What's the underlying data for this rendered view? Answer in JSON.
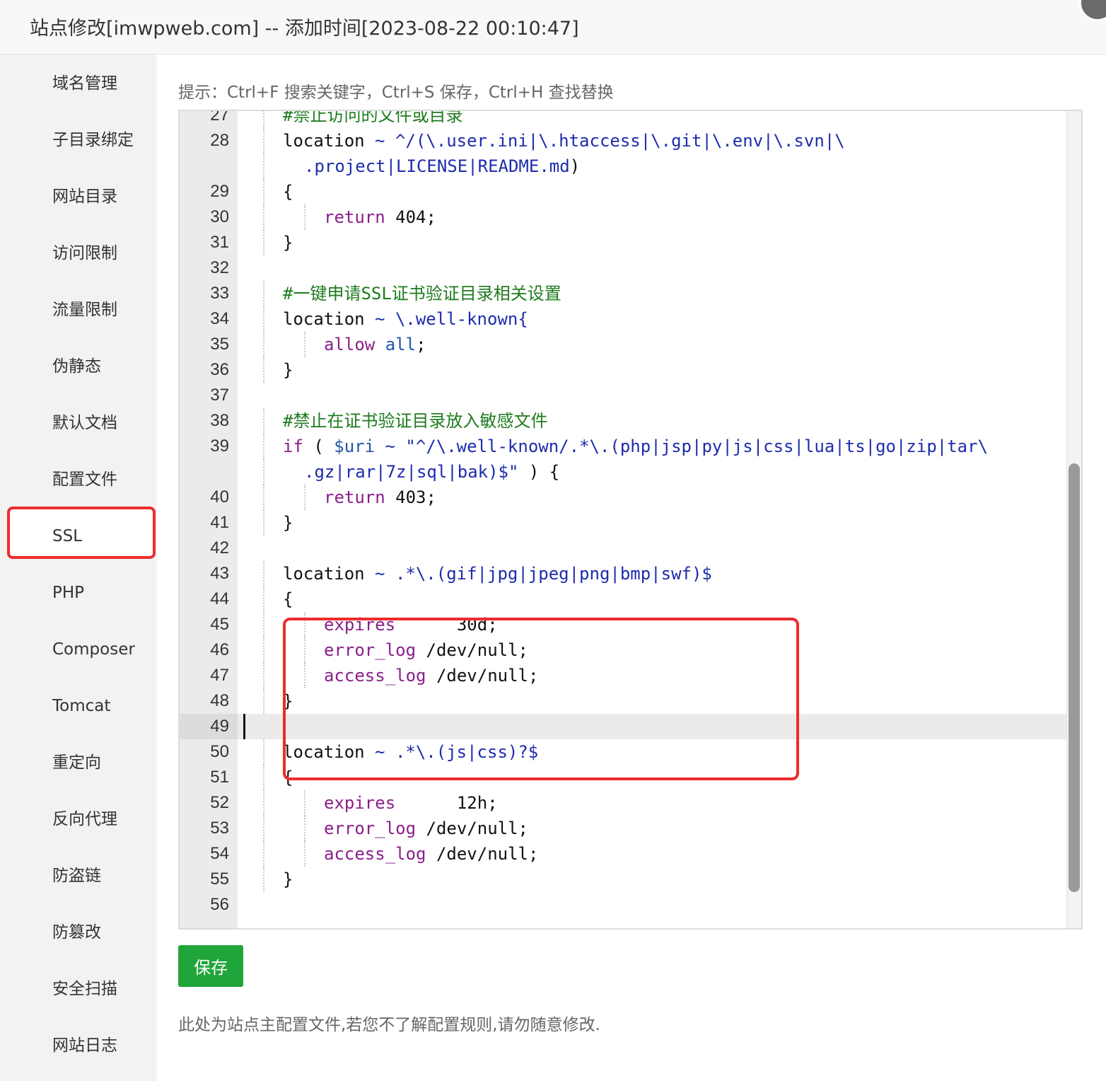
{
  "dialog": {
    "title": "站点修改[imwpweb.com] -- 添加时间[2023-08-22 00:10:47]"
  },
  "sidebar": {
    "items": [
      {
        "label": "域名管理"
      },
      {
        "label": "子目录绑定"
      },
      {
        "label": "网站目录"
      },
      {
        "label": "访问限制"
      },
      {
        "label": "流量限制"
      },
      {
        "label": "伪静态"
      },
      {
        "label": "默认文档"
      },
      {
        "label": "配置文件",
        "active": true
      },
      {
        "label": "SSL"
      },
      {
        "label": "PHP"
      },
      {
        "label": "Composer"
      },
      {
        "label": "Tomcat"
      },
      {
        "label": "重定向"
      },
      {
        "label": "反向代理"
      },
      {
        "label": "防盗链"
      },
      {
        "label": "防篡改"
      },
      {
        "label": "安全扫描"
      },
      {
        "label": "网站日志"
      }
    ]
  },
  "main": {
    "tip": "提示：Ctrl+F 搜索关键字，Ctrl+S 保存，Ctrl+H 查找替换",
    "save_label": "保存",
    "note": "此处为站点主配置文件,若您不了解配置规则,请勿随意修改."
  },
  "editor": {
    "current_line": 49,
    "lines": [
      {
        "n": "27",
        "text": "#禁止访问的文件或目录"
      },
      {
        "n": "28",
        "text": "location ~ ^/(\\.user.ini|\\.htaccess|\\.git|\\.env|\\.svn|\\"
      },
      {
        "n": "",
        "text": ".project|LICENSE|README.md)"
      },
      {
        "n": "29",
        "text": "{"
      },
      {
        "n": "30",
        "text": "return 404;"
      },
      {
        "n": "31",
        "text": "}"
      },
      {
        "n": "32",
        "text": ""
      },
      {
        "n": "33",
        "text": "#一键申请SSL证书验证目录相关设置"
      },
      {
        "n": "34",
        "text": "location ~ \\.well-known{"
      },
      {
        "n": "35",
        "text": "allow all;"
      },
      {
        "n": "36",
        "text": "}"
      },
      {
        "n": "37",
        "text": ""
      },
      {
        "n": "38",
        "text": "#禁止在证书验证目录放入敏感文件"
      },
      {
        "n": "39",
        "text": "if ( $uri ~ \"^/\\.well-known/.*\\.(php|jsp|py|js|css|lua|ts|go|zip|tar\\"
      },
      {
        "n": "",
        "text": ".gz|rar|7z|sql|bak)$\" ) {"
      },
      {
        "n": "40",
        "text": "return 403;"
      },
      {
        "n": "41",
        "text": "}"
      },
      {
        "n": "42",
        "text": ""
      },
      {
        "n": "43",
        "text": "location ~ .*\\.(gif|jpg|jpeg|png|bmp|swf)$"
      },
      {
        "n": "44",
        "text": "{"
      },
      {
        "n": "45",
        "text": "expires      30d;"
      },
      {
        "n": "46",
        "text": "error_log /dev/null;"
      },
      {
        "n": "47",
        "text": "access_log /dev/null;"
      },
      {
        "n": "48",
        "text": "}"
      },
      {
        "n": "49",
        "text": ""
      },
      {
        "n": "50",
        "text": "location ~ .*\\.(js|css)?$"
      },
      {
        "n": "51",
        "text": "{"
      },
      {
        "n": "52",
        "text": "expires      12h;"
      },
      {
        "n": "53",
        "text": "error_log /dev/null;"
      },
      {
        "n": "54",
        "text": "access_log /dev/null;"
      },
      {
        "n": "55",
        "text": "}"
      },
      {
        "n": "56",
        "text": ""
      }
    ]
  },
  "colors": {
    "accent_green": "#20a53a",
    "highlight_red": "#ee2c2c",
    "comment_green": "#1e7b1e",
    "keyword_purple": "#8a1f8a",
    "string_blue": "#1d2cad"
  }
}
